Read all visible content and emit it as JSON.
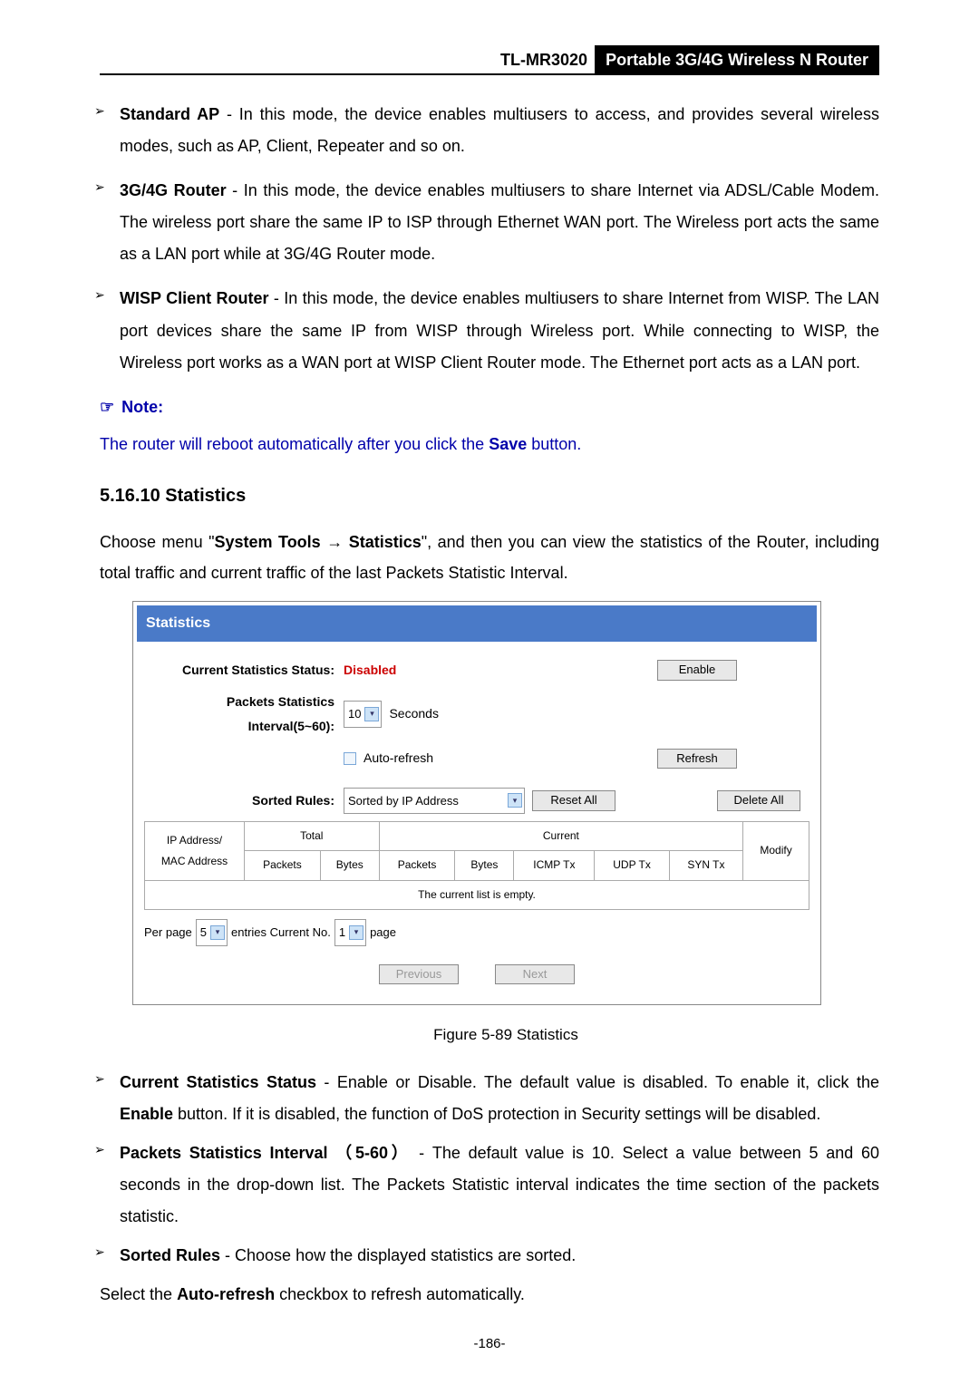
{
  "header": {
    "model": "TL-MR3020",
    "product": "Portable 3G/4G Wireless N Router"
  },
  "bullets_top": [
    {
      "title": "Standard AP",
      "body": " - In this mode, the device enables multiusers to access, and provides several wireless modes, such as AP, Client, Repeater and so on."
    },
    {
      "title": "3G/4G Router",
      "body": " - In this mode, the device enables multiusers to share Internet via ADSL/Cable Modem. The wireless port share the same IP to ISP through Ethernet WAN port. The Wireless port acts the same as a LAN port while at 3G/4G Router mode."
    },
    {
      "title": "WISP Client Router",
      "body": " - In this mode, the device enables multiusers to share Internet from WISP. The LAN port devices share the same IP from WISP through Wireless port. While connecting to WISP, the Wireless port works as a WAN port at WISP Client Router mode. The Ethernet port acts as a LAN port."
    }
  ],
  "note": {
    "label": "Note:",
    "body_pre": "The router will reboot automatically after you click the ",
    "body_bold": "Save",
    "body_post": " button."
  },
  "section": {
    "number": "5.16.10",
    "title": "Statistics"
  },
  "section_para": {
    "pre": "Choose menu \"",
    "b1": "System Tools",
    "arrow": " → ",
    "b2": "Statistics",
    "post": "\", and then you can view the statistics of the Router, including total traffic and current traffic of the last Packets Statistic Interval."
  },
  "figure": {
    "title": "Statistics",
    "labels": {
      "status": "Current Statistics Status:",
      "status_value": "Disabled",
      "interval": "Packets Statistics Interval(5~60):",
      "interval_value": "10",
      "interval_unit": "Seconds",
      "auto_refresh": "Auto-refresh",
      "sorted_rules": "Sorted Rules:",
      "sorted_value": "Sorted by IP Address",
      "per_page_pre": "Per page",
      "per_page_value": "5",
      "per_page_mid": "entries  Current No.",
      "per_page_no": "1",
      "per_page_post": "page"
    },
    "buttons": {
      "enable": "Enable",
      "refresh": "Refresh",
      "reset_all": "Reset All",
      "delete_all": "Delete All",
      "previous": "Previous",
      "next": "Next"
    },
    "table": {
      "group_total": "Total",
      "group_current": "Current",
      "cols": {
        "ip": "IP Address/\nMAC Address",
        "packets": "Packets",
        "bytes": "Bytes",
        "packets2": "Packets",
        "bytes2": "Bytes",
        "icmp": "ICMP Tx",
        "udp": "UDP Tx",
        "syn": "SYN Tx",
        "modify": "Modify"
      },
      "empty": "The current list is empty."
    },
    "caption": "Figure 5-89   Statistics"
  },
  "bullets_bottom": [
    {
      "title": "Current Statistics Status",
      "body_pre": " - Enable or Disable. The default value is disabled. To enable it, click the ",
      "body_bold": "Enable",
      "body_post": " button. If it is disabled, the function of DoS protection in Security settings will be disabled."
    },
    {
      "title": "Packets Statistics Interval",
      "extra": " （5-60）",
      "body_pre": " - The default value is 10. Select a value between 5 and 60 seconds in the drop-down list. The Packets Statistic interval indicates the time section of the packets statistic.",
      "body_bold": "",
      "body_post": ""
    },
    {
      "title": "Sorted Rules",
      "body_pre": " - Choose how the displayed statistics are sorted.",
      "body_bold": "",
      "body_post": ""
    }
  ],
  "tail": {
    "pre": "Select the ",
    "bold": "Auto-refresh",
    "post": " checkbox to refresh automatically."
  },
  "page_number": "-186-"
}
